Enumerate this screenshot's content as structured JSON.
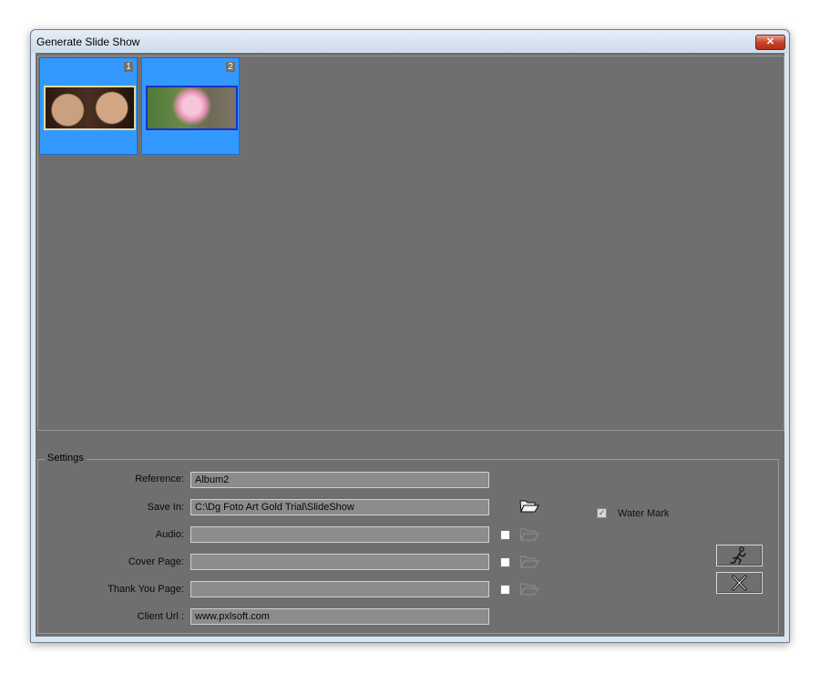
{
  "window": {
    "title": "Generate Slide Show",
    "close_label": "✕"
  },
  "thumbnails": [
    {
      "number": "1",
      "image": "couple-photo"
    },
    {
      "number": "2",
      "image": "rose-photo"
    }
  ],
  "settings": {
    "legend": "Settings",
    "reference": {
      "label": "Reference:",
      "value": "Album2"
    },
    "save_in": {
      "label": "Save In:",
      "value": "C:\\Dg Foto Art Gold Trial\\SlideShow"
    },
    "audio": {
      "label": "Audio:",
      "value": ""
    },
    "cover_page": {
      "label": "Cover Page:",
      "value": ""
    },
    "thank_you_page": {
      "label": "Thank You Page:",
      "value": ""
    },
    "client_url": {
      "label": "Client Url :",
      "value": "www.pxlsoft.com"
    },
    "water_mark": {
      "label": "Water Mark",
      "checked": true
    }
  },
  "icons": {
    "folder": "folder-open-icon",
    "run": "running-man-icon",
    "cancel": "cancel-x-icon"
  },
  "colors": {
    "selection": "#3399ff",
    "panel": "#6f6f6f"
  }
}
